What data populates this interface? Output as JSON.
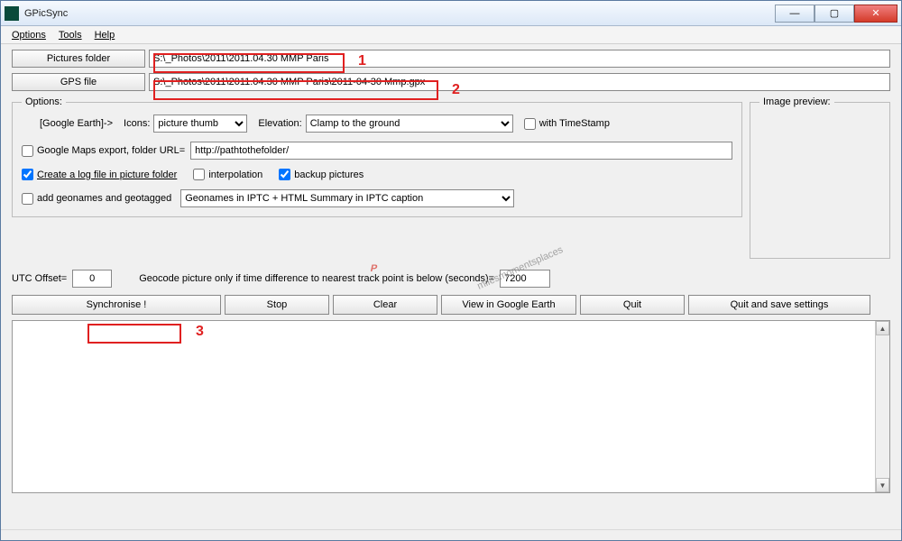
{
  "window": {
    "title": "GPicSync"
  },
  "menu": {
    "options": "Options",
    "tools": "Tools",
    "help": "Help"
  },
  "paths": {
    "pictures_label": "Pictures folder",
    "pictures_value": "S:\\_Photos\\2011\\2011.04.30 MMP Paris",
    "gps_label": "GPS file",
    "gps_value": "S:\\_Photos\\2011\\2011.04.30 MMP Paris\\2011-04-30 Mmp.gpx"
  },
  "annotations": {
    "n1": "1",
    "n2": "2",
    "n3": "3"
  },
  "options": {
    "legend": "Options:",
    "ge_label": "[Google Earth]->",
    "icons_label": "Icons:",
    "icons_value": "picture thumb",
    "elevation_label": "Elevation:",
    "elevation_value": "Clamp to the ground",
    "timestamp_label": "with TimeStamp",
    "gmaps_label": "Google Maps export, folder URL=",
    "gmaps_value": "http://pathtothefolder/",
    "log_label": "Create a log file in picture folder",
    "interp_label": "interpolation",
    "backup_label": "backup pictures",
    "geonames_label": "add geonames and geotagged",
    "geonames_value": "Geonames in IPTC + HTML Summary in IPTC caption"
  },
  "preview": {
    "legend": "Image preview:"
  },
  "utc": {
    "offset_label": "UTC Offset=",
    "offset_value": "0",
    "geocode_label": "Geocode picture only if time difference to nearest track point is below (seconds)=",
    "geocode_value": "7200"
  },
  "buttons": {
    "sync": "Synchronise !",
    "stop": "Stop",
    "clear": "Clear",
    "view_ge": "View in Google Earth",
    "quit": "Quit",
    "quit_save": "Quit and save settings"
  }
}
